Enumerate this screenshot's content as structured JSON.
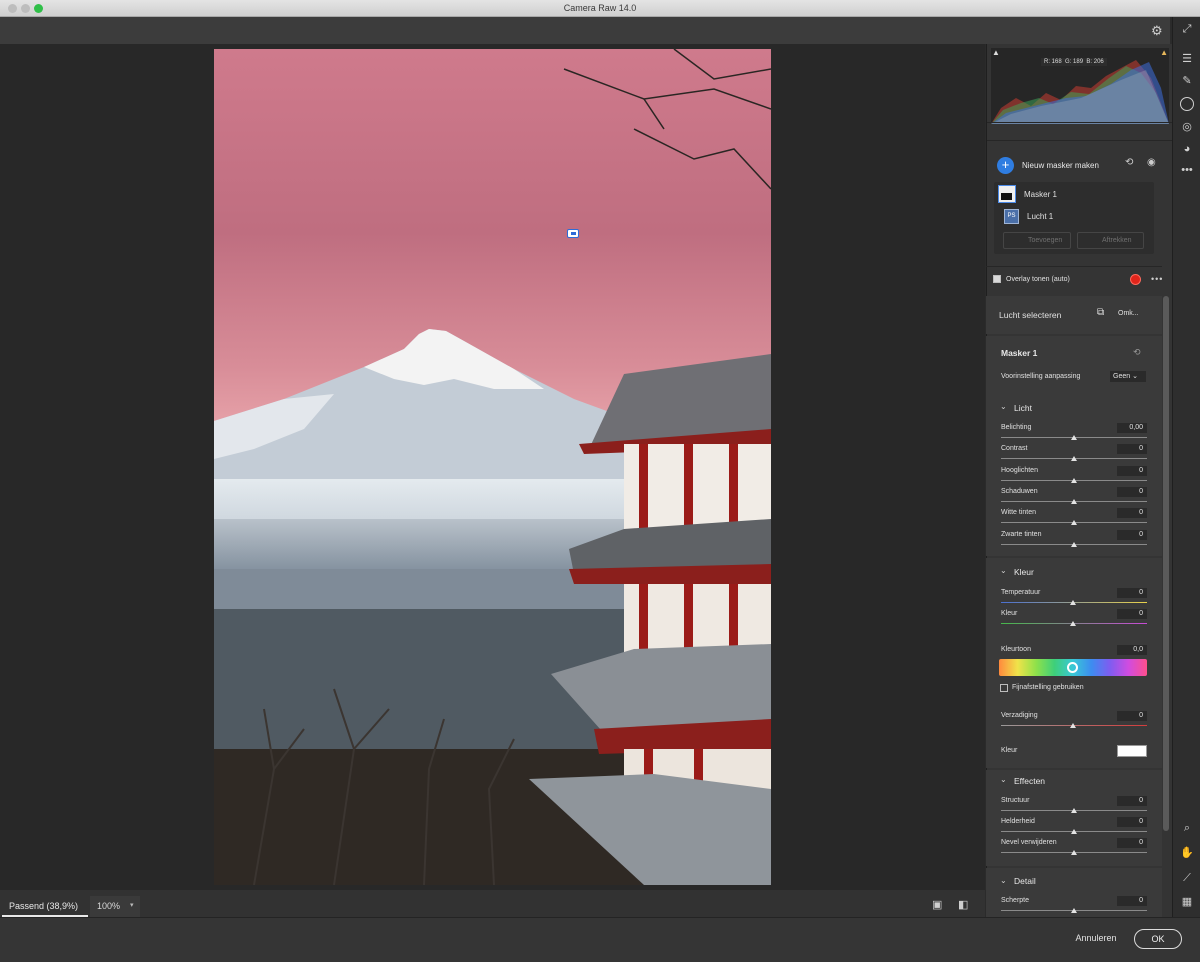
{
  "window": {
    "title": "Camera Raw 14.0"
  },
  "colors": {
    "accent": "#2f7de1",
    "overlay_color": "#e1251b",
    "panel_bg": "#343434"
  },
  "icons": {
    "settings": "gear-icon",
    "fullscreen": "expand-icon",
    "edit": "sliders-icon",
    "heal": "brush-icon",
    "masking": "mask-icon",
    "redeye": "eye-icon",
    "presets": "circles-icon",
    "more": "more-icon",
    "zoom": "magnifier-icon",
    "hand": "hand-icon",
    "sampler": "eyedropper-icon",
    "grid": "grid-icon"
  },
  "histogram": {
    "r": "R: 168",
    "g": "G: 189",
    "b": "B: 206"
  },
  "masks": {
    "new_mask_label": "Nieuw masker maken",
    "items": [
      {
        "name": "Masker 1"
      },
      {
        "name": "Lucht 1"
      }
    ],
    "add_label": "Toevoegen",
    "subtract_label": "Aftrekken",
    "overlay_label": "Overlay tonen (auto)",
    "overlay_checked": true
  },
  "sky": {
    "select_label": "Lucht selecteren",
    "invert_label": "Omk..."
  },
  "mask_panel": {
    "title": "Masker 1",
    "preset_label": "Voorinstelling aanpassing",
    "preset_value": "Geen"
  },
  "light": {
    "title": "Licht",
    "sliders": [
      {
        "label": "Belichting",
        "value": "0,00",
        "pos": 0.5
      },
      {
        "label": "Contrast",
        "value": "0",
        "pos": 0.5
      },
      {
        "label": "Hooglichten",
        "value": "0",
        "pos": 0.5
      },
      {
        "label": "Schaduwen",
        "value": "0",
        "pos": 0.5
      },
      {
        "label": "Witte tinten",
        "value": "0",
        "pos": 0.5
      },
      {
        "label": "Zwarte tinten",
        "value": "0",
        "pos": 0.5
      }
    ]
  },
  "color": {
    "title": "Kleur",
    "temperature_label": "Temperatuur",
    "temperature_value": "0",
    "tint_label": "Kleur",
    "tint_value": "0",
    "hue_label": "Kleurtoon",
    "hue_value": "0,0",
    "fine_label": "Fijnafstelling gebruiken",
    "fine_checked": false,
    "saturation_label": "Verzadiging",
    "saturation_value": "0",
    "swatch_label": "Kleur"
  },
  "effects": {
    "title": "Effecten",
    "sliders": [
      {
        "label": "Structuur",
        "value": "0",
        "pos": 0.5
      },
      {
        "label": "Helderheid",
        "value": "0",
        "pos": 0.5
      },
      {
        "label": "Nevel verwijderen",
        "value": "0",
        "pos": 0.5
      }
    ]
  },
  "detail": {
    "title": "Detail",
    "sliders": [
      {
        "label": "Scherpte",
        "value": "0",
        "pos": 0.5
      }
    ]
  },
  "zoom": {
    "fit_label": "Passend (38,9%)",
    "percent_label": "100%"
  },
  "footer": {
    "cancel_label": "Annuleren",
    "ok_label": "OK"
  }
}
